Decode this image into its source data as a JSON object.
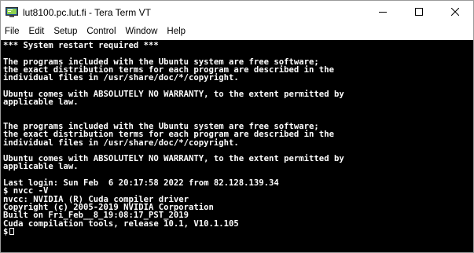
{
  "window": {
    "title": "lut8100.pc.lut.fi - Tera Term VT",
    "icon": "teraterm-monitor-icon",
    "controls": [
      "minimize-icon",
      "maximize-icon",
      "close-icon"
    ]
  },
  "menu": [
    {
      "label": "File"
    },
    {
      "label": "Edit"
    },
    {
      "label": "Setup"
    },
    {
      "label": "Control"
    },
    {
      "label": "Window"
    },
    {
      "label": "Help"
    }
  ],
  "terminal": {
    "background": "#000000",
    "foreground": "#ffffff",
    "lines": [
      "*** System restart required ***",
      "",
      "The programs included with the Ubuntu system are free software;",
      "the exact distribution terms for each program are described in the",
      "individual files in /usr/share/doc/*/copyright.",
      "",
      "Ubuntu comes with ABSOLUTELY NO WARRANTY, to the extent permitted by",
      "applicable law.",
      "",
      "",
      "The programs included with the Ubuntu system are free software;",
      "the exact distribution terms for each program are described in the",
      "individual files in /usr/share/doc/*/copyright.",
      "",
      "Ubuntu comes with ABSOLUTELY NO WARRANTY, to the extent permitted by",
      "applicable law.",
      "",
      "Last login: Sun Feb  6 20:17:58 2022 from 82.128.139.34",
      "$ nvcc -V",
      "nvcc: NVIDIA (R) Cuda compiler driver",
      "Copyright (c) 2005-2019 NVIDIA Corporation",
      "Built on Fri_Feb__8_19:08:17_PST_2019",
      "Cuda compilation tools, release 10.1, V10.1.105"
    ],
    "prompt": "$"
  }
}
